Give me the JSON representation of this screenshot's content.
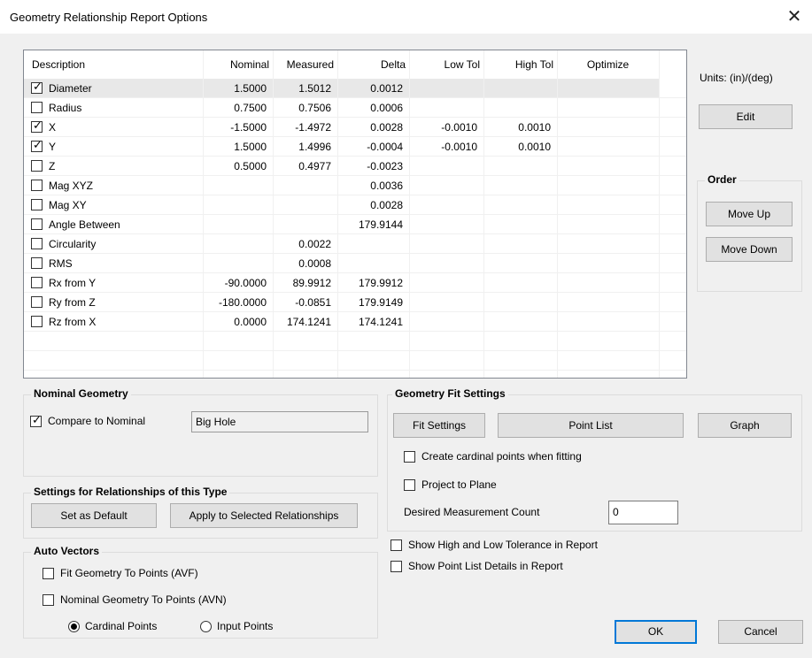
{
  "window": {
    "title": "Geometry Relationship Report Options"
  },
  "table": {
    "headers": [
      "Description",
      "Nominal",
      "Measured",
      "Delta",
      "Low Tol",
      "High Tol",
      "Optimize"
    ],
    "rows": [
      {
        "checked": true,
        "desc": "Diameter",
        "nominal": "1.5000",
        "measured": "1.5012",
        "delta": "0.0012",
        "low": "",
        "high": ""
      },
      {
        "checked": false,
        "desc": "Radius",
        "nominal": "0.7500",
        "measured": "0.7506",
        "delta": "0.0006",
        "low": "",
        "high": ""
      },
      {
        "checked": true,
        "desc": "X",
        "nominal": "-1.5000",
        "measured": "-1.4972",
        "delta": "0.0028",
        "low": "-0.0010",
        "high": "0.0010"
      },
      {
        "checked": true,
        "desc": "Y",
        "nominal": "1.5000",
        "measured": "1.4996",
        "delta": "-0.0004",
        "low": "-0.0010",
        "high": "0.0010"
      },
      {
        "checked": false,
        "desc": "Z",
        "nominal": "0.5000",
        "measured": "0.4977",
        "delta": "-0.0023",
        "low": "",
        "high": ""
      },
      {
        "checked": false,
        "desc": "Mag XYZ",
        "nominal": "",
        "measured": "",
        "delta": "0.0036",
        "low": "",
        "high": ""
      },
      {
        "checked": false,
        "desc": "Mag XY",
        "nominal": "",
        "measured": "",
        "delta": "0.0028",
        "low": "",
        "high": ""
      },
      {
        "checked": false,
        "desc": "Angle Between",
        "nominal": "",
        "measured": "",
        "delta": "179.9144",
        "low": "",
        "high": ""
      },
      {
        "checked": false,
        "desc": "Circularity",
        "nominal": "",
        "measured": "0.0022",
        "delta": "",
        "low": "",
        "high": ""
      },
      {
        "checked": false,
        "desc": "RMS",
        "nominal": "",
        "measured": "0.0008",
        "delta": "",
        "low": "",
        "high": ""
      },
      {
        "checked": false,
        "desc": "Rx from Y",
        "nominal": "-90.0000",
        "measured": "89.9912",
        "delta": "179.9912",
        "low": "",
        "high": ""
      },
      {
        "checked": false,
        "desc": "Ry from Z",
        "nominal": "-180.0000",
        "measured": "-0.0851",
        "delta": "179.9149",
        "low": "",
        "high": ""
      },
      {
        "checked": false,
        "desc": "Rz from X",
        "nominal": "0.0000",
        "measured": "174.1241",
        "delta": "174.1241",
        "low": "",
        "high": ""
      }
    ]
  },
  "right": {
    "units": "Units: (in)/(deg)",
    "edit": "Edit",
    "order_title": "Order",
    "move_up": "Move Up",
    "move_down": "Move Down"
  },
  "nominal_geometry": {
    "title": "Nominal Geometry",
    "compare_label": "Compare to Nominal",
    "compare_checked": true,
    "geometry_name": "Big Hole"
  },
  "settings_type": {
    "title": "Settings for Relationships of this Type",
    "set_default": "Set as Default",
    "apply_selected": "Apply to Selected Relationships"
  },
  "auto_vectors": {
    "title": "Auto Vectors",
    "avf_label": "Fit Geometry To Points (AVF)",
    "avn_label": "Nominal Geometry To Points (AVN)",
    "cardinal_label": "Cardinal Points",
    "input_label": "Input Points",
    "selected": "cardinal"
  },
  "fit_settings": {
    "title": "Geometry Fit Settings",
    "fit_button": "Fit Settings",
    "point_list_button": "Point List",
    "graph_button": "Graph",
    "cardinal_label": "Create cardinal points when fitting",
    "project_label": "Project to Plane",
    "desired_label": "Desired Measurement Count",
    "desired_value": "0"
  },
  "report": {
    "show_tol_label": "Show High and Low Tolerance in Report",
    "show_points_label": "Show Point List Details in Report"
  },
  "footer": {
    "ok": "OK",
    "cancel": "Cancel"
  }
}
